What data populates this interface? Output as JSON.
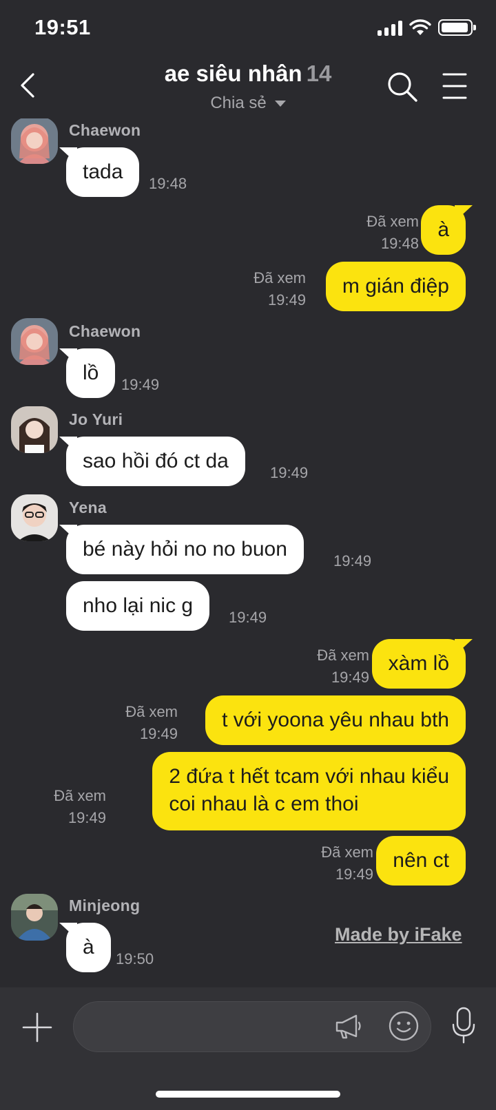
{
  "status_bar": {
    "time": "19:51",
    "battery_level": 0.95,
    "signal_bars": 4
  },
  "header": {
    "title": "ae siêu nhân",
    "member_count": "14",
    "subtitle": "Chia sẻ",
    "icons": {
      "back": "chevron-left-icon",
      "search": "search-icon",
      "menu": "hamburger-menu-icon"
    }
  },
  "messages": [
    {
      "type": "incoming",
      "sender": "Chaewon",
      "text": "tada",
      "time": "19:48"
    },
    {
      "type": "outgoing",
      "seen": "Đã xem",
      "text": "à",
      "time": "19:48"
    },
    {
      "type": "outgoing",
      "seen": "Đã xem",
      "text": "m gián điệp",
      "time": "19:49"
    },
    {
      "type": "incoming",
      "sender": "Chaewon",
      "text": "lồ",
      "time": "19:49"
    },
    {
      "type": "incoming",
      "sender": "Jo Yuri",
      "text": "sao hồi đó ct da",
      "time": "19:49"
    },
    {
      "type": "incoming",
      "sender": "Yena",
      "text": "bé này hỏi no no buon",
      "time": "19:49"
    },
    {
      "type": "incoming",
      "text": "nho lại nic g",
      "time": "19:49"
    },
    {
      "type": "outgoing",
      "seen": "Đã xem",
      "text": "xàm lồ",
      "time": "19:49"
    },
    {
      "type": "outgoing",
      "seen": "Đã xem",
      "text": "t với yoona yêu nhau bth",
      "time": "19:49"
    },
    {
      "type": "outgoing",
      "seen": "Đã xem",
      "text_line1": "2 đứa t hết tcam với nhau kiểu",
      "text_line2": "coi nhau là c em thoi",
      "time": "19:49"
    },
    {
      "type": "outgoing",
      "seen": "Đã xem",
      "text": "nên ct",
      "time": "19:49"
    },
    {
      "type": "incoming",
      "sender": "Minjeong",
      "text": "à",
      "time": "19:50"
    }
  ],
  "watermark": "Made by iFake",
  "input_bar": {
    "placeholder": "",
    "icons": {
      "plus": "plus-icon",
      "megaphone": "megaphone-icon",
      "emoji": "emoji-icon",
      "mic": "microphone-icon"
    }
  },
  "colors": {
    "background": "#2a2a2e",
    "incoming_bubble": "#ffffff",
    "outgoing_bubble": "#fbe30f",
    "meta_text": "#a6a6aa"
  }
}
